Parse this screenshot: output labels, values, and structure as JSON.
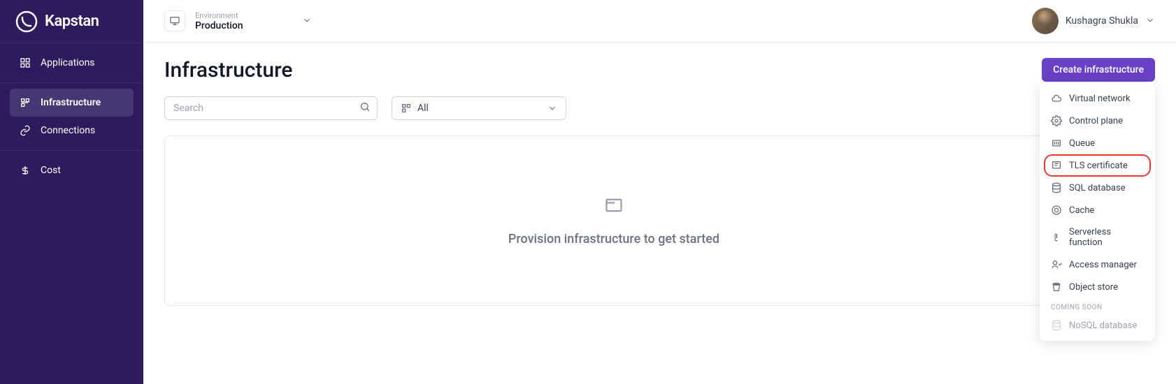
{
  "brand": "Kapstan",
  "sidebar": {
    "items": [
      {
        "label": "Applications"
      },
      {
        "label": "Infrastructure"
      },
      {
        "label": "Connections"
      },
      {
        "label": "Cost"
      }
    ]
  },
  "environment": {
    "label": "Environment",
    "value": "Production"
  },
  "user": {
    "name": "Kushagra Shukla"
  },
  "page": {
    "title": "Infrastructure"
  },
  "search": {
    "placeholder": "Search"
  },
  "filter": {
    "value": "All"
  },
  "empty": {
    "message": "Provision infrastructure to get started"
  },
  "create_button": "Create infrastructure",
  "dropdown": {
    "items": [
      {
        "label": "Virtual network"
      },
      {
        "label": "Control plane"
      },
      {
        "label": "Queue"
      },
      {
        "label": "TLS certificate"
      },
      {
        "label": "SQL database"
      },
      {
        "label": "Cache"
      },
      {
        "label": "Serverless function"
      },
      {
        "label": "Access manager"
      },
      {
        "label": "Object store"
      }
    ],
    "coming_soon_label": "COMING SOON",
    "coming_soon_items": [
      {
        "label": "NoSQL database"
      }
    ]
  }
}
